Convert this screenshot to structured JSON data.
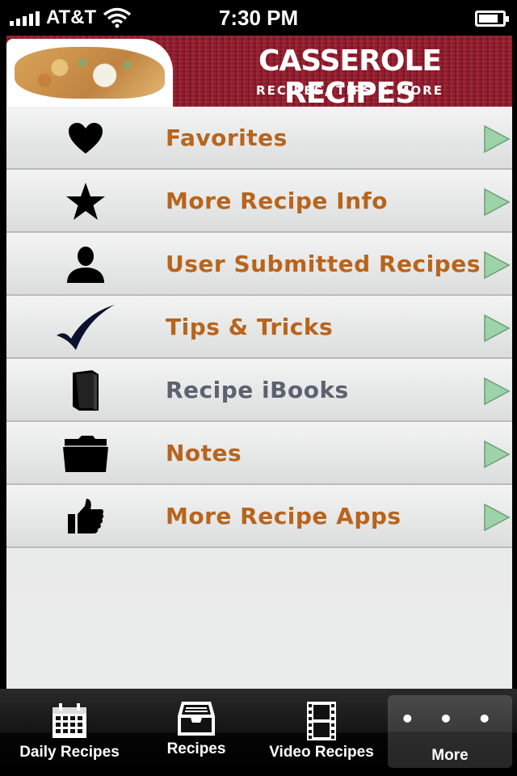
{
  "status_bar": {
    "carrier": "AT&T",
    "time": "7:30 PM"
  },
  "header": {
    "title": "CASSEROLE RECIPES",
    "subtitle": "RECIPES, TIPS & MORE"
  },
  "menu": {
    "items": [
      {
        "label": "Favorites",
        "icon": "heart-icon"
      },
      {
        "label": "More Recipe Info",
        "icon": "star-icon"
      },
      {
        "label": "User Submitted Recipes",
        "icon": "user-icon"
      },
      {
        "label": "Tips & Tricks",
        "icon": "checkmark-icon"
      },
      {
        "label": "Recipe iBooks",
        "icon": "book-icon"
      },
      {
        "label": "Notes",
        "icon": "folder-icon"
      },
      {
        "label": "More Recipe Apps",
        "icon": "thumbs-up-icon"
      }
    ]
  },
  "tabbar": {
    "tabs": [
      {
        "label": "Daily Recipes",
        "icon": "calendar-icon"
      },
      {
        "label": "Recipes",
        "icon": "inbox-tray-icon"
      },
      {
        "label": "Video Recipes",
        "icon": "film-icon"
      },
      {
        "label": "More",
        "icon": "more-dots-icon"
      }
    ],
    "selected": "More"
  },
  "colors": {
    "menu_label": "#b8641c",
    "menu_label_alt": "#5b6270",
    "banner_red": "#8b1a2a",
    "arrow_green": "#9ed2a8"
  }
}
